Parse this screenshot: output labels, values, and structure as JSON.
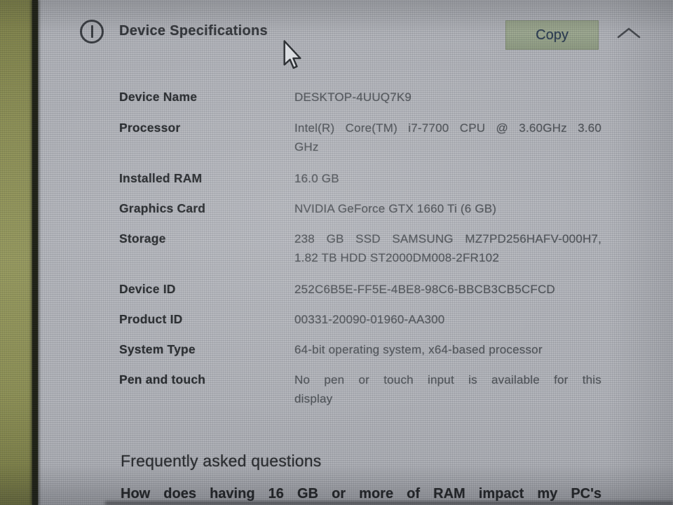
{
  "header": {
    "title": "Device Specifications",
    "copy_label": "Copy",
    "icons": {
      "left": "info-icon",
      "collapse": "chevron-up-icon"
    }
  },
  "specs": {
    "rows": [
      {
        "label": "Device Name",
        "lines": [
          "DESKTOP-4UUQ7K9"
        ]
      },
      {
        "label": "Processor",
        "lines": [
          "Intel(R) Core(TM) i7-7700 CPU @ 3.60GHz 3.60",
          "GHz"
        ]
      },
      {
        "label": "Installed RAM",
        "lines": [
          "16.0 GB"
        ]
      },
      {
        "label": "Graphics Card",
        "lines": [
          "NVIDIA GeForce GTX 1660 Ti (6 GB)"
        ]
      },
      {
        "label": "Storage",
        "lines": [
          "238 GB SSD SAMSUNG MZ7PD256HAFV-000H7,",
          "1.82 TB HDD ST2000DM008-2FR102"
        ]
      },
      {
        "label": "Device ID",
        "lines": [
          "252C6B5E-FF5E-4BE8-98C6-BBCB3CB5CFCD"
        ]
      },
      {
        "label": "Product ID",
        "lines": [
          "00331-20090-01960-AA300"
        ]
      },
      {
        "label": "System Type",
        "lines": [
          "64-bit operating system, x64-based processor"
        ]
      },
      {
        "label": "Pen and touch",
        "lines": [
          "No pen or touch input is available for this",
          "display"
        ]
      }
    ]
  },
  "faq": {
    "heading": "Frequently asked questions",
    "first_question": "How does having 16 GB or more of RAM impact my PC's"
  },
  "colors": {
    "screen_background": "#b3b5bb",
    "copy_button_background": "#97a289",
    "copy_button_text": "#27384e",
    "label_text": "#24272a",
    "value_text": "#4d5156",
    "screen_edge_strip": "#8d9054"
  }
}
